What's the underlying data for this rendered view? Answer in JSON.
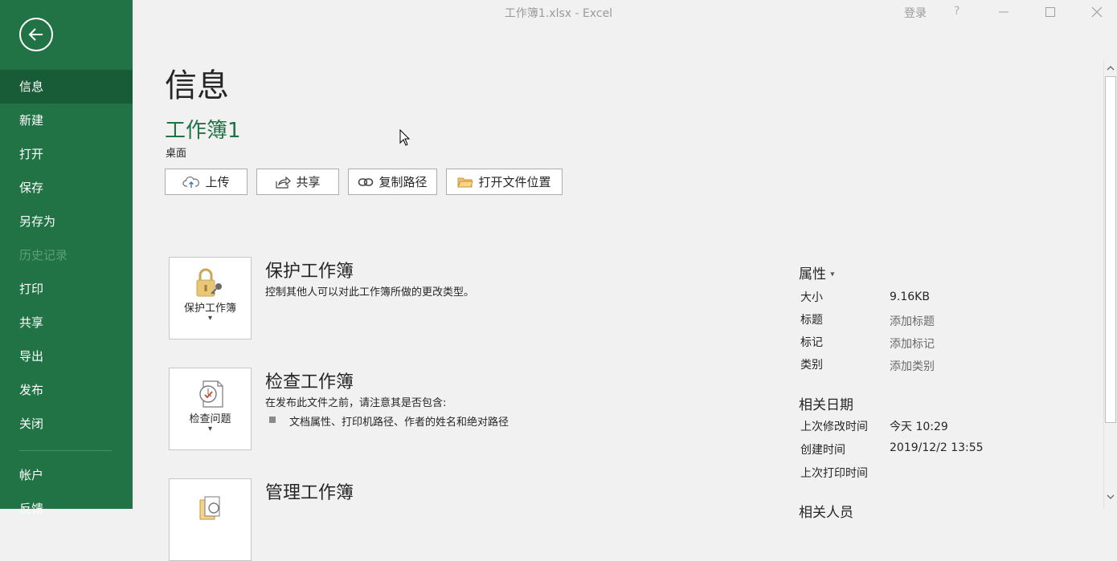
{
  "titlebar": {
    "title": "工作簿1.xlsx  -  Excel",
    "signin": "登录",
    "help": "?"
  },
  "sidebar": {
    "items": [
      {
        "label": "信息"
      },
      {
        "label": "新建"
      },
      {
        "label": "打开"
      },
      {
        "label": "保存"
      },
      {
        "label": "另存为"
      },
      {
        "label": "历史记录"
      },
      {
        "label": "打印"
      },
      {
        "label": "共享"
      },
      {
        "label": "导出"
      },
      {
        "label": "发布"
      },
      {
        "label": "关闭"
      },
      {
        "label": "帐户"
      },
      {
        "label": "反馈"
      }
    ]
  },
  "main": {
    "title": "信息",
    "doc_name": "工作簿1",
    "doc_location": "桌面",
    "actions": {
      "upload": "上传",
      "share": "共享",
      "copy_path": "复制路径",
      "open_location": "打开文件位置"
    },
    "protect": {
      "tile_label": "保护工作簿",
      "title": "保护工作簿",
      "desc": "控制其他人可以对此工作簿所做的更改类型。"
    },
    "inspect": {
      "tile_label": "检查问题",
      "title": "检查工作簿",
      "desc": "在发布此文件之前，请注意其是否包含:",
      "bullet": "文档属性、打印机路径、作者的姓名和绝对路径"
    },
    "manage": {
      "title": "管理工作簿"
    }
  },
  "properties": {
    "heading": "属性",
    "size_label": "大小",
    "size_value": "9.16KB",
    "title_label": "标题",
    "title_value": "添加标题",
    "tags_label": "标记",
    "tags_value": "添加标记",
    "category_label": "类别",
    "category_value": "添加类别",
    "dates_heading": "相关日期",
    "modified_label": "上次修改时间",
    "modified_value": "今天 10:29",
    "created_label": "创建时间",
    "created_value": "2019/12/2 13:55",
    "printed_label": "上次打印时间",
    "people_heading": "相关人员"
  },
  "colors": {
    "sidebar_bg": "#217346",
    "sidebar_active": "#185c37",
    "accent_text": "#217346",
    "page_bg": "#f1f1f1"
  }
}
